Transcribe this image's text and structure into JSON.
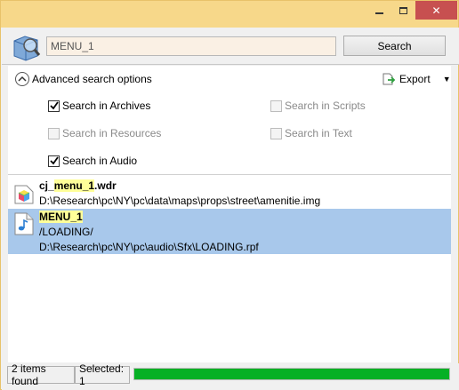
{
  "window": {
    "controls": {
      "minimize": "minimize",
      "maximize": "maximize",
      "close": "✕"
    }
  },
  "search": {
    "query": "MENU_1",
    "button_label": "Search"
  },
  "options": {
    "advanced_label": "Advanced search options",
    "export_label": "Export",
    "checkboxes": [
      {
        "label": "Search in Archives",
        "checked": true,
        "enabled": true
      },
      {
        "label": "Search in Scripts",
        "checked": false,
        "enabled": false
      },
      {
        "label": "Search in Resources",
        "checked": false,
        "enabled": false
      },
      {
        "label": "Search in Text",
        "checked": false,
        "enabled": false
      },
      {
        "label": "Search in Audio",
        "checked": true,
        "enabled": true
      }
    ]
  },
  "results": [
    {
      "icon": "model-cube-icon",
      "name_prefix": "cj_",
      "name_match": "menu_1",
      "name_suffix": ".wdr",
      "lines": [
        "D:\\Research\\pc\\NY\\pc\\data\\maps\\props\\street\\amenitie.img"
      ],
      "selected": false
    },
    {
      "icon": "audio-file-icon",
      "name_prefix": "",
      "name_match": "MENU_1",
      "name_suffix": "",
      "lines": [
        "/LOADING/",
        "D:\\Research\\pc\\NY\\pc\\audio\\Sfx\\LOADING.rpf"
      ],
      "selected": true
    }
  ],
  "status": {
    "items_found": "2 items found",
    "selected": "Selected: 1",
    "progress": 1.0
  },
  "colors": {
    "accent_frame": "#f7d88a",
    "selection": "#a8c8eb",
    "highlight": "#ffff99",
    "progress": "#06b025",
    "close": "#c75050"
  }
}
